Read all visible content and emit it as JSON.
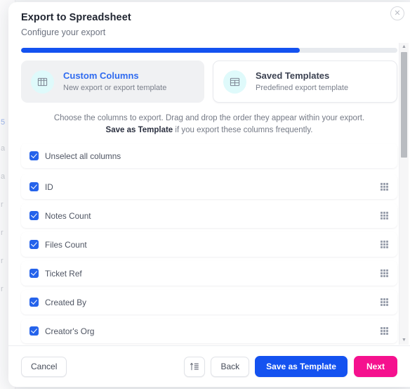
{
  "modal": {
    "title": "Export to Spreadsheet",
    "subtitle": "Configure your export",
    "close_icon": "close-circle-icon",
    "progress": {
      "percent": 74,
      "fill_color": "#1452f0",
      "track_color": "#e7eaee"
    }
  },
  "tabs": [
    {
      "title": "Custom Columns",
      "subtitle": "New export or export template",
      "icon": "table-grid-icon",
      "active": true,
      "accent": "#2f6bf0"
    },
    {
      "title": "Saved Templates",
      "subtitle": "Predefined export template",
      "icon": "table-grid-icon",
      "active": false,
      "accent": "#3c4252"
    }
  ],
  "helper": {
    "line1": "Choose the columns to export. Drag and drop the order they appear within your export.",
    "line2_bold": "Save as Template",
    "line2_rest": " if you export these columns frequently."
  },
  "select_all_row": {
    "label": "Unselect all columns",
    "checked": true
  },
  "columns": [
    {
      "label": "ID",
      "checked": true,
      "handle_icon": "drag-handle-icon"
    },
    {
      "label": "Notes Count",
      "checked": true,
      "handle_icon": "drag-handle-icon"
    },
    {
      "label": "Files Count",
      "checked": true,
      "handle_icon": "drag-handle-icon"
    },
    {
      "label": "Ticket Ref",
      "checked": true,
      "handle_icon": "drag-handle-icon"
    },
    {
      "label": "Created By",
      "checked": true,
      "handle_icon": "drag-handle-icon"
    },
    {
      "label": "Creator's Org",
      "checked": true,
      "handle_icon": "drag-handle-icon"
    }
  ],
  "footer": {
    "cancel": "Cancel",
    "sort_icon": "sort-order-icon",
    "back": "Back",
    "save_as_template": "Save as Template",
    "next": "Next",
    "primary_color": "#1452f0",
    "next_color": "#f5118e"
  },
  "scrollbar": {
    "up_icon": "caret-up-icon",
    "down_icon": "caret-down-icon"
  },
  "background_ghosts": [
    "5",
    "a",
    "a",
    "r",
    "r",
    "r",
    "r"
  ]
}
